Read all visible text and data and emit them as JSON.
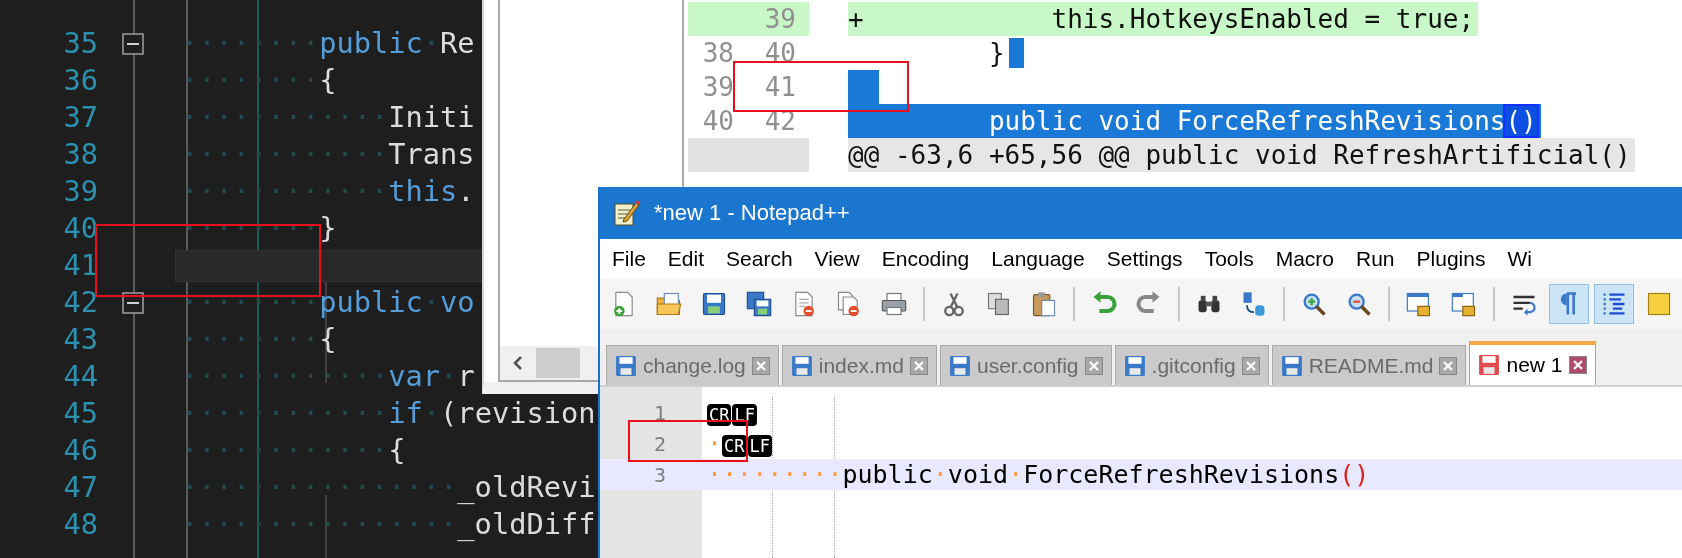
{
  "code_editor": {
    "lines": [
      {
        "number": "35",
        "fold": true,
        "current": false,
        "tokens": [
          {
            "kind": "ws",
            "text": "········"
          },
          {
            "kind": "kw",
            "text": "public"
          },
          {
            "kind": "ws",
            "text": "·"
          },
          {
            "kind": "id",
            "text": "Re"
          }
        ]
      },
      {
        "number": "36",
        "fold": false,
        "current": false,
        "tokens": [
          {
            "kind": "ws",
            "text": "········"
          },
          {
            "kind": "id",
            "text": "{"
          }
        ]
      },
      {
        "number": "37",
        "fold": false,
        "current": false,
        "tokens": [
          {
            "kind": "ws",
            "text": "············"
          },
          {
            "kind": "id",
            "text": "Initi"
          }
        ]
      },
      {
        "number": "38",
        "fold": false,
        "current": false,
        "tokens": [
          {
            "kind": "ws",
            "text": "············"
          },
          {
            "kind": "id",
            "text": "Trans"
          }
        ]
      },
      {
        "number": "39",
        "fold": false,
        "current": false,
        "tokens": [
          {
            "kind": "ws",
            "text": "············"
          },
          {
            "kind": "kw",
            "text": "this"
          },
          {
            "kind": "id",
            "text": "."
          }
        ]
      },
      {
        "number": "40",
        "fold": false,
        "current": false,
        "tokens": [
          {
            "kind": "ws",
            "text": "········"
          },
          {
            "kind": "id",
            "text": "}"
          }
        ]
      },
      {
        "number": "41",
        "fold": false,
        "current": true
      },
      {
        "number": "42",
        "fold": true,
        "current": false,
        "tokens": [
          {
            "kind": "ws",
            "text": "········"
          },
          {
            "kind": "kw",
            "text": "public"
          },
          {
            "kind": "ws",
            "text": "·"
          },
          {
            "kind": "kw",
            "text": "vo"
          }
        ]
      },
      {
        "number": "43",
        "fold": false,
        "current": false,
        "tokens": [
          {
            "kind": "ws",
            "text": "········"
          },
          {
            "kind": "id",
            "text": "{"
          }
        ]
      },
      {
        "number": "44",
        "fold": false,
        "current": false,
        "tokens": [
          {
            "kind": "ws",
            "text": "············"
          },
          {
            "kind": "kw",
            "text": "var"
          },
          {
            "kind": "ws",
            "text": "·"
          },
          {
            "kind": "id",
            "text": "r"
          }
        ]
      },
      {
        "number": "45",
        "fold": false,
        "current": false,
        "tokens": [
          {
            "kind": "ws",
            "text": "············"
          },
          {
            "kind": "kw",
            "text": "if"
          },
          {
            "kind": "ws",
            "text": "·"
          },
          {
            "kind": "id",
            "text": "(revision"
          }
        ]
      },
      {
        "number": "46",
        "fold": false,
        "current": false,
        "tokens": [
          {
            "kind": "ws",
            "text": "············"
          },
          {
            "kind": "id",
            "text": "{"
          }
        ]
      },
      {
        "number": "47",
        "fold": false,
        "current": false,
        "tokens": [
          {
            "kind": "ws",
            "text": "················"
          },
          {
            "kind": "id",
            "text": "_oldRevi"
          }
        ]
      },
      {
        "number": "48",
        "fold": false,
        "current": false,
        "tokens": [
          {
            "kind": "ws",
            "text": "················"
          },
          {
            "kind": "id",
            "text": "_oldDiff"
          }
        ]
      }
    ]
  },
  "diff_view": {
    "rows": [
      {
        "kind": "added",
        "new": "39",
        "text": "+            this.HotkeysEnabled = true;",
        "selected": false
      },
      {
        "kind": "context",
        "old": "38",
        "new": "40",
        "text": "         }",
        "selected": true
      },
      {
        "kind": "context",
        "old": "39",
        "new": "41",
        "selected": true
      },
      {
        "kind": "context",
        "old": "40",
        "new": "42",
        "text": "         public void ForceRefreshRevisions",
        "match": "()",
        "selected": true
      },
      {
        "kind": "hunk",
        "text": "@@ -63,6 +65,56 @@ public void RefreshArtificial()",
        "selected": false
      }
    ]
  },
  "notepad": {
    "title": "*new 1 - Notepad++",
    "menu": [
      "File",
      "Edit",
      "Search",
      "View",
      "Encoding",
      "Language",
      "Settings",
      "Tools",
      "Macro",
      "Run",
      "Plugins",
      "Wi"
    ],
    "toolbar": [
      [
        {
          "kind": "new",
          "pressed": false
        },
        {
          "kind": "open",
          "pressed": false
        },
        {
          "kind": "save",
          "pressed": false
        },
        {
          "kind": "save-all",
          "pressed": false
        },
        {
          "kind": "close",
          "pressed": false
        },
        {
          "kind": "close-all",
          "pressed": false
        },
        {
          "kind": "print",
          "pressed": false
        }
      ],
      [
        {
          "kind": "cut",
          "pressed": false
        },
        {
          "kind": "copy",
          "pressed": false
        },
        {
          "kind": "paste",
          "pressed": false
        }
      ],
      [
        {
          "kind": "undo",
          "pressed": false
        },
        {
          "kind": "redo",
          "pressed": false
        }
      ],
      [
        {
          "kind": "find",
          "pressed": false
        },
        {
          "kind": "replace",
          "pressed": false
        }
      ],
      [
        {
          "kind": "zoom-in",
          "pressed": false
        },
        {
          "kind": "zoom-out",
          "pressed": false
        }
      ],
      [
        {
          "kind": "sync-v",
          "pressed": false
        },
        {
          "kind": "sync-h",
          "pressed": false
        }
      ],
      [
        {
          "kind": "wrap",
          "pressed": false
        },
        {
          "kind": "all-chars",
          "pressed": true
        },
        {
          "kind": "indent-guide",
          "pressed": true
        },
        {
          "kind": "doc-map",
          "pressed": false
        }
      ]
    ],
    "tabs": [
      {
        "label": "change.log",
        "selected": false
      },
      {
        "label": "index.md",
        "selected": false
      },
      {
        "label": "user.config",
        "selected": false
      },
      {
        "label": ".gitconfig",
        "selected": false
      },
      {
        "label": "README.md",
        "selected": false
      },
      {
        "label": "new 1",
        "selected": true
      }
    ],
    "lines": [
      {
        "number": "1",
        "current": false,
        "tokens": [
          {
            "kind": "eol",
            "text": "CR"
          },
          {
            "kind": "eol",
            "text": "LF"
          }
        ]
      },
      {
        "number": "2",
        "current": false,
        "tokens": [
          {
            "kind": "ws",
            "text": "·"
          },
          {
            "kind": "eol",
            "text": "CR"
          },
          {
            "kind": "eol",
            "text": "LF"
          }
        ]
      },
      {
        "number": "3",
        "current": true,
        "tokens": [
          {
            "kind": "ws",
            "text": "·········"
          },
          {
            "kind": "code",
            "text": "public"
          },
          {
            "kind": "ws",
            "text": "·"
          },
          {
            "kind": "code",
            "text": "void"
          },
          {
            "kind": "ws",
            "text": "·"
          },
          {
            "kind": "code",
            "text": "ForceRefreshRevisions"
          },
          {
            "kind": "brace",
            "text": "()"
          }
        ]
      }
    ]
  }
}
